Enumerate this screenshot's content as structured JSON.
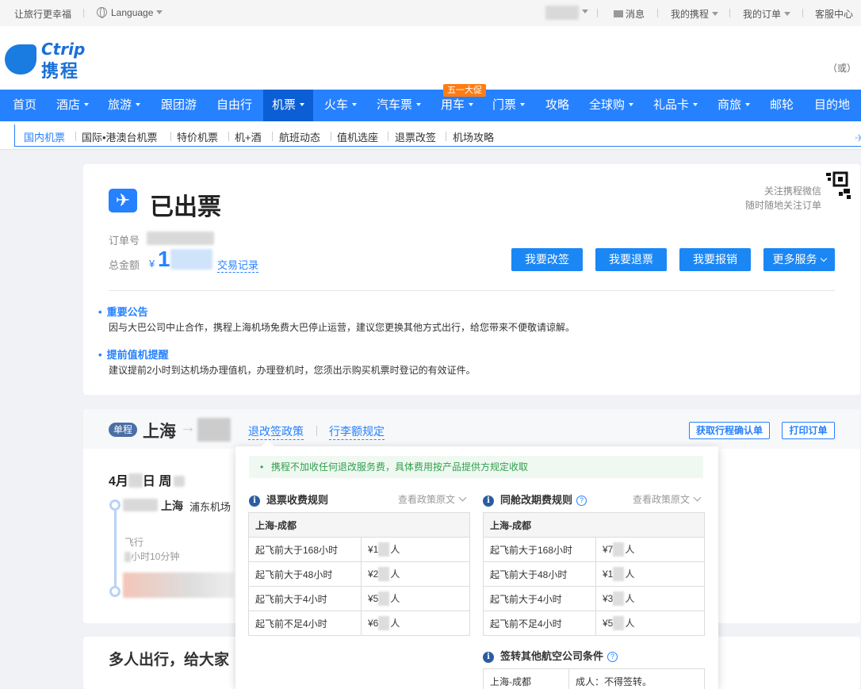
{
  "topbar": {
    "slogan": "让旅行更幸福",
    "language": "Language",
    "messages": "消息",
    "my_ctrip": "我的携程",
    "my_orders": "我的订单",
    "service": "客服中心"
  },
  "header": {
    "logo_en": "Ctrip",
    "logo_cn": "携程",
    "or_text": "（或）"
  },
  "nav": {
    "items": [
      {
        "label": "首页"
      },
      {
        "label": "酒店"
      },
      {
        "label": "旅游"
      },
      {
        "label": "跟团游"
      },
      {
        "label": "自由行"
      },
      {
        "label": "机票"
      },
      {
        "label": "火车"
      },
      {
        "label": "汽车票"
      },
      {
        "label": "用车"
      },
      {
        "label": "门票"
      },
      {
        "label": "攻略"
      },
      {
        "label": "全球购"
      },
      {
        "label": "礼品卡"
      },
      {
        "label": "商旅"
      },
      {
        "label": "邮轮"
      },
      {
        "label": "目的地"
      }
    ],
    "promo_badge": "五一大促",
    "active": "机票"
  },
  "subnav": {
    "items": [
      {
        "label": "国内机票"
      },
      {
        "label": "国际•港澳台机票"
      },
      {
        "label": "特价机票"
      },
      {
        "label": "机+酒"
      },
      {
        "label": "航班动态"
      },
      {
        "label": "值机选座"
      },
      {
        "label": "退票改签"
      },
      {
        "label": "机场攻略"
      }
    ]
  },
  "order": {
    "status": "已出票",
    "wechat_line1": "关注携程微信",
    "wechat_line2": "随时随地关注订单",
    "order_no_label": "订单号",
    "total_label": "总金额",
    "currency": "¥",
    "amount_visible": "1",
    "trade_record": "交易记录",
    "buttons": {
      "change": "我要改签",
      "refund": "我要退票",
      "reimburse": "我要报销",
      "more": "更多服务"
    },
    "notices": [
      {
        "title": "重要公告",
        "body": "因与大巴公司中止合作，携程上海机场免费大巴停止运营，建议您更换其他方式出行，给您带来不便敬请谅解。"
      },
      {
        "title": "提前值机提醒",
        "body": "建议提前2小时到达机场办理值机，办理登机时，您须出示购买机票时登记的有效证件。"
      }
    ]
  },
  "segment": {
    "badge": "单程",
    "from": "上海",
    "policy_link": "退改签政策",
    "baggage_link": "行李额规定",
    "confirm_btn": "获取行程确认单",
    "print_btn": "打印订单",
    "date_month": "4月",
    "date_day_suffix": "日 周",
    "depart_city": "上海",
    "depart_airport": "浦东机场",
    "flight_label": "飞行",
    "duration": "小时10分钟"
  },
  "policy": {
    "tip": "携程不加收任何退改服务费，具体费用按产品提供方规定收取",
    "view_original": "查看政策原文",
    "refund": {
      "title": "退票收费规则",
      "route": "上海-成都",
      "rows": [
        {
          "cond": "起飞前大于168小时",
          "fee_prefix": "¥1",
          "fee_suffix": "人"
        },
        {
          "cond": "起飞前大于48小时",
          "fee_prefix": "¥2",
          "fee_suffix": "人"
        },
        {
          "cond": "起飞前大于4小时",
          "fee_prefix": "¥5",
          "fee_suffix": "人"
        },
        {
          "cond": "起飞前不足4小时",
          "fee_prefix": "¥6",
          "fee_suffix": "人"
        }
      ]
    },
    "change": {
      "title": "同舱改期费规则",
      "route": "上海-成都",
      "rows": [
        {
          "cond": "起飞前大于168小时",
          "fee_prefix": "¥7",
          "fee_suffix": "人"
        },
        {
          "cond": "起飞前大于48小时",
          "fee_prefix": "¥1",
          "fee_suffix": "人"
        },
        {
          "cond": "起飞前大于4小时",
          "fee_prefix": "¥3",
          "fee_suffix": "人"
        },
        {
          "cond": "起飞前不足4小时",
          "fee_prefix": "¥5",
          "fee_suffix": "人"
        }
      ]
    },
    "endorse": {
      "title": "签转其他航空公司条件",
      "route": "上海-成都",
      "value": "成人：不得签转。"
    }
  },
  "multi": {
    "title": "多人出行，给大家"
  },
  "colors": {
    "nav_blue": "#2681ff",
    "nav_active": "#0b5ed4",
    "button_blue": "#1a87f5",
    "promo_orange": "#ff7d13",
    "tip_green": "#2fa14c"
  }
}
